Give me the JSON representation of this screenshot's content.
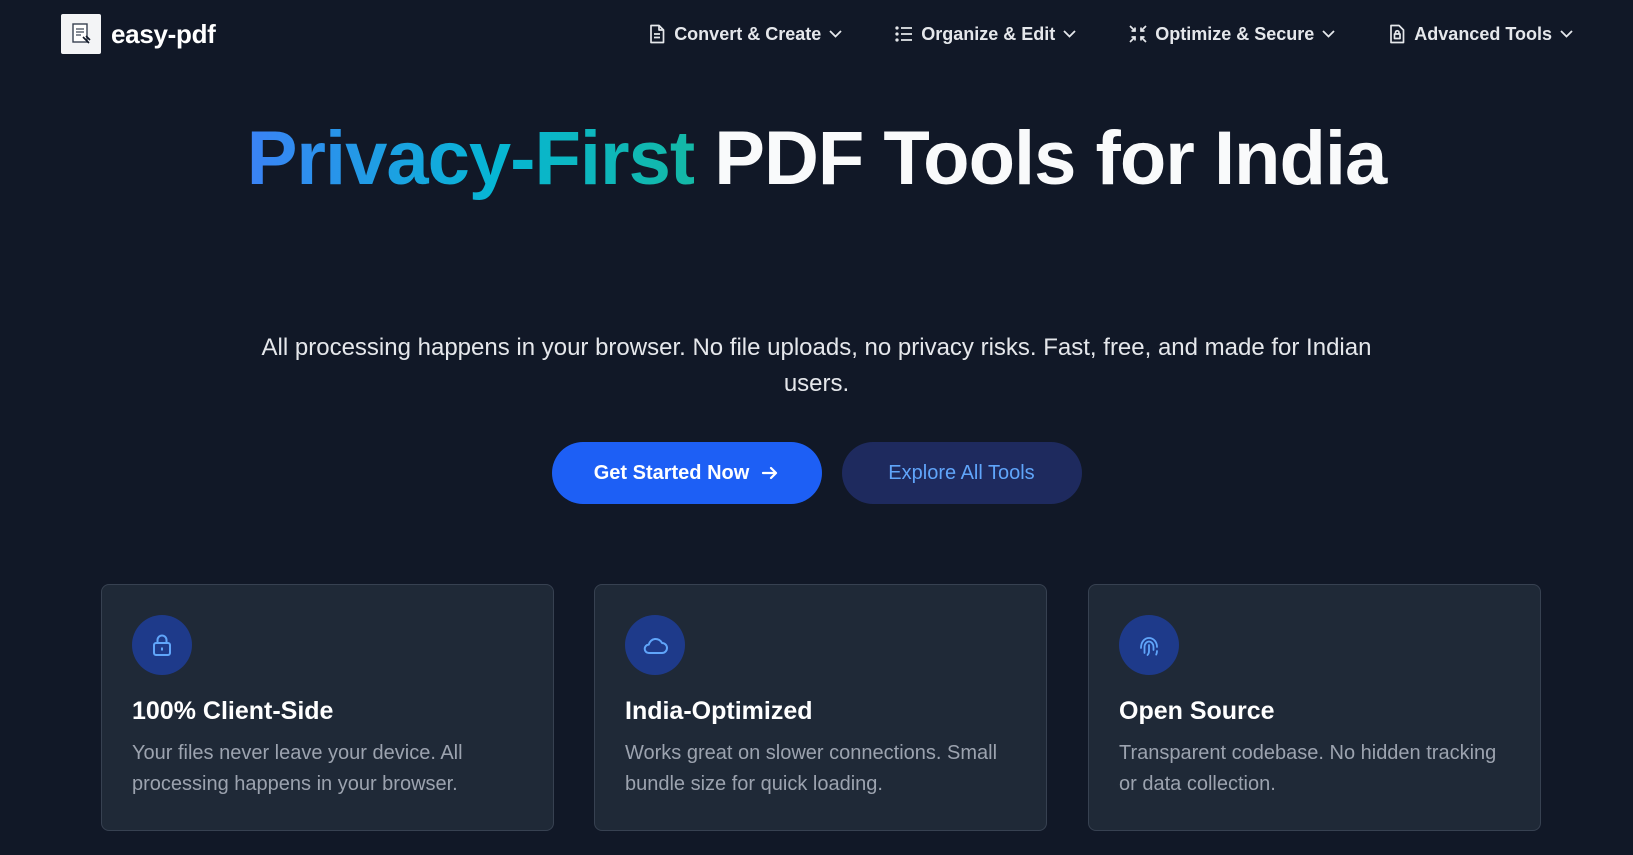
{
  "header": {
    "brand_name": "easy-pdf",
    "nav": [
      {
        "label": "Convert & Create",
        "icon": "document-icon"
      },
      {
        "label": "Organize & Edit",
        "icon": "list-icon"
      },
      {
        "label": "Optimize & Secure",
        "icon": "compress-icon"
      },
      {
        "label": "Advanced Tools",
        "icon": "lock-document-icon"
      }
    ]
  },
  "hero": {
    "title_highlight": "Privacy-First",
    "title_rest": " PDF Tools for India",
    "subtitle": "All processing happens in your browser. No file uploads, no privacy risks. Fast, free, and made for Indian users.",
    "primary_cta": "Get Started Now",
    "secondary_cta": "Explore All Tools"
  },
  "features": [
    {
      "icon": "lock-icon",
      "title": "100% Client-Side",
      "description": "Your files never leave your device. All processing happens in your browser."
    },
    {
      "icon": "cloud-icon",
      "title": "India-Optimized",
      "description": "Works great on slower connections. Small bundle size for quick loading."
    },
    {
      "icon": "fingerprint-icon",
      "title": "Open Source",
      "description": "Transparent codebase. No hidden tracking or data collection."
    }
  ],
  "colors": {
    "background": "#111827",
    "card_background": "#1f2937",
    "primary_button": "#1d5ff5",
    "secondary_button": "#1e2a5e",
    "accent_gradient_start": "#3b82f6",
    "accent_gradient_end": "#14b8a6",
    "icon_circle": "#1e3a8a"
  }
}
